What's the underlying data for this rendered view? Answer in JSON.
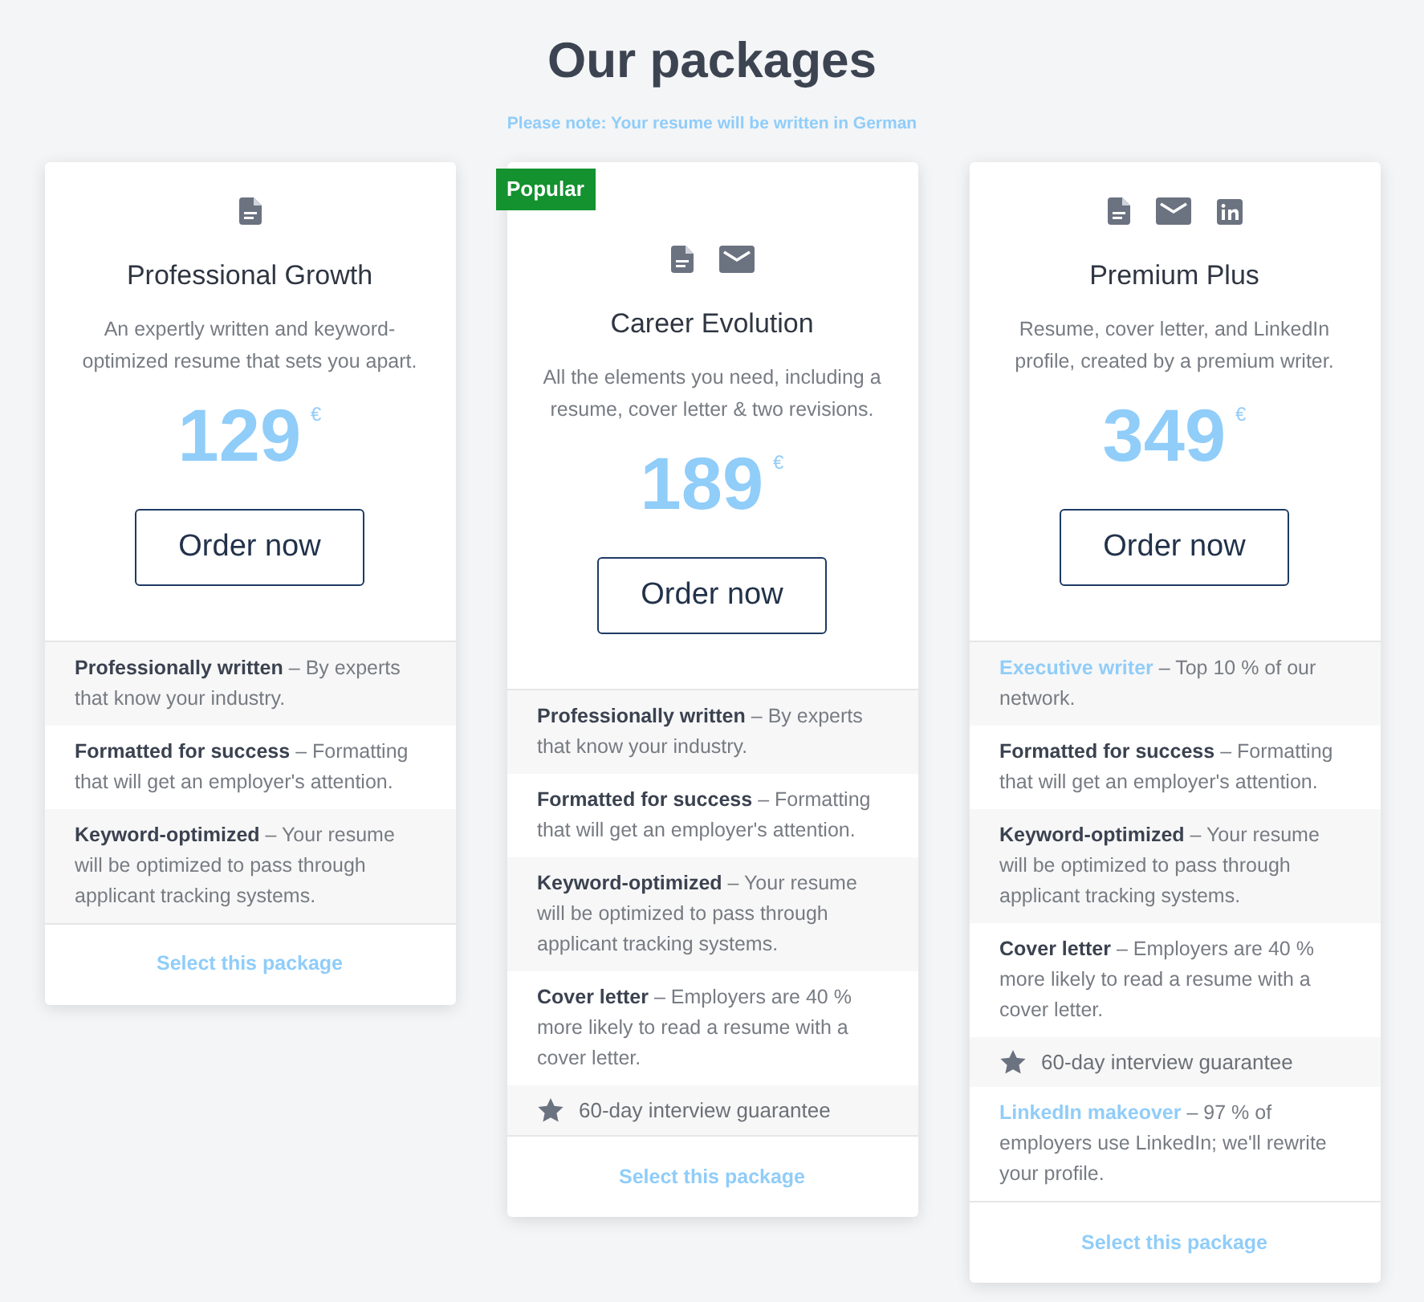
{
  "title": "Our packages",
  "note": "Please note: Your resume will be written in German",
  "packages": [
    {
      "icons": [
        {
          "kind": "document"
        }
      ],
      "name": "Professional Growth",
      "description": "An expertly written and keyword-optimized resume that sets you apart.",
      "price": "129",
      "currency": "€",
      "order_button": "Order now",
      "features": [
        {
          "kind": "feature",
          "term": "Professionally written",
          "text": "– By experts that know your industry.",
          "highlight": false
        },
        {
          "kind": "feature",
          "term": "Formatted for success",
          "text": "– Formatting that will get an employer's attention.",
          "highlight": false
        },
        {
          "kind": "feature",
          "term": "Keyword-optimized",
          "text": "– Your resume will be optimized to pass through applicant tracking systems.",
          "highlight": false
        }
      ],
      "select_link": "Select this package"
    },
    {
      "badge": "Popular",
      "icons": [
        {
          "kind": "document"
        },
        {
          "kind": "mail"
        }
      ],
      "name": "Career Evolution",
      "description": "All the elements you need, including a resume, cover letter & two revisions.",
      "price": "189",
      "currency": "€",
      "order_button": "Order now",
      "features": [
        {
          "kind": "feature",
          "term": "Professionally written",
          "text": "– By experts that know your industry.",
          "highlight": false
        },
        {
          "kind": "feature",
          "term": "Formatted for success",
          "text": "– Formatting that will get an employer's attention.",
          "highlight": false
        },
        {
          "kind": "feature",
          "term": "Keyword-optimized",
          "text": "– Your resume will be optimized to pass through applicant tracking systems.",
          "highlight": false
        },
        {
          "kind": "feature",
          "term": "Cover letter",
          "text": "– Employers are 40 % more likely to read a resume with a cover letter.",
          "highlight": false
        },
        {
          "kind": "guarantee",
          "text": "60-day interview guarantee"
        }
      ],
      "select_link": "Select this package"
    },
    {
      "icons": [
        {
          "kind": "document"
        },
        {
          "kind": "mail"
        },
        {
          "kind": "linkedin"
        }
      ],
      "name": "Premium Plus",
      "description": "Resume, cover letter, and LinkedIn profile, created by a premium writer.",
      "price": "349",
      "currency": "€",
      "order_button": "Order now",
      "features": [
        {
          "kind": "feature",
          "term": "Executive writer",
          "text": "– Top 10 % of our network.",
          "highlight": true
        },
        {
          "kind": "feature",
          "term": "Formatted for success",
          "text": "– Formatting that will get an employer's attention.",
          "highlight": false
        },
        {
          "kind": "feature",
          "term": "Keyword-optimized",
          "text": "– Your resume will be optimized to pass through applicant tracking systems.",
          "highlight": false
        },
        {
          "kind": "feature",
          "term": "Cover letter",
          "text": "– Employers are 40 % more likely to read a resume with a cover letter.",
          "highlight": false
        },
        {
          "kind": "guarantee",
          "text": "60-day interview guarantee"
        },
        {
          "kind": "feature",
          "term": "LinkedIn makeover",
          "text": "– 97 % of employers use LinkedIn; we'll rewrite your profile.",
          "highlight": true
        }
      ],
      "select_link": "Select this package"
    }
  ]
}
